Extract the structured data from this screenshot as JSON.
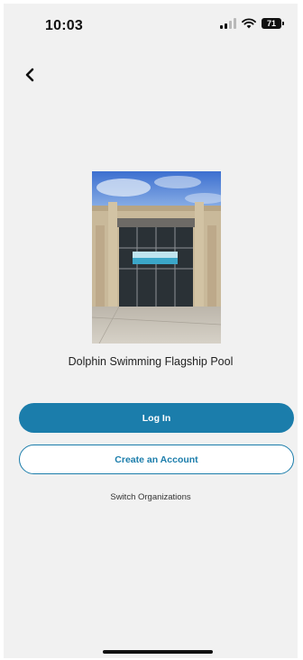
{
  "status_bar": {
    "time": "10:03",
    "battery": "71"
  },
  "nav": {
    "back_icon": "chevron-left-icon"
  },
  "venue": {
    "name": "Dolphin Swimming Flagship Pool",
    "image": "building-entrance-photo"
  },
  "actions": {
    "login_label": "Log In",
    "create_account_label": "Create an Account",
    "switch_org_label": "Switch Organizations"
  },
  "colors": {
    "accent": "#1b7dab",
    "background": "#f1f1f1"
  }
}
